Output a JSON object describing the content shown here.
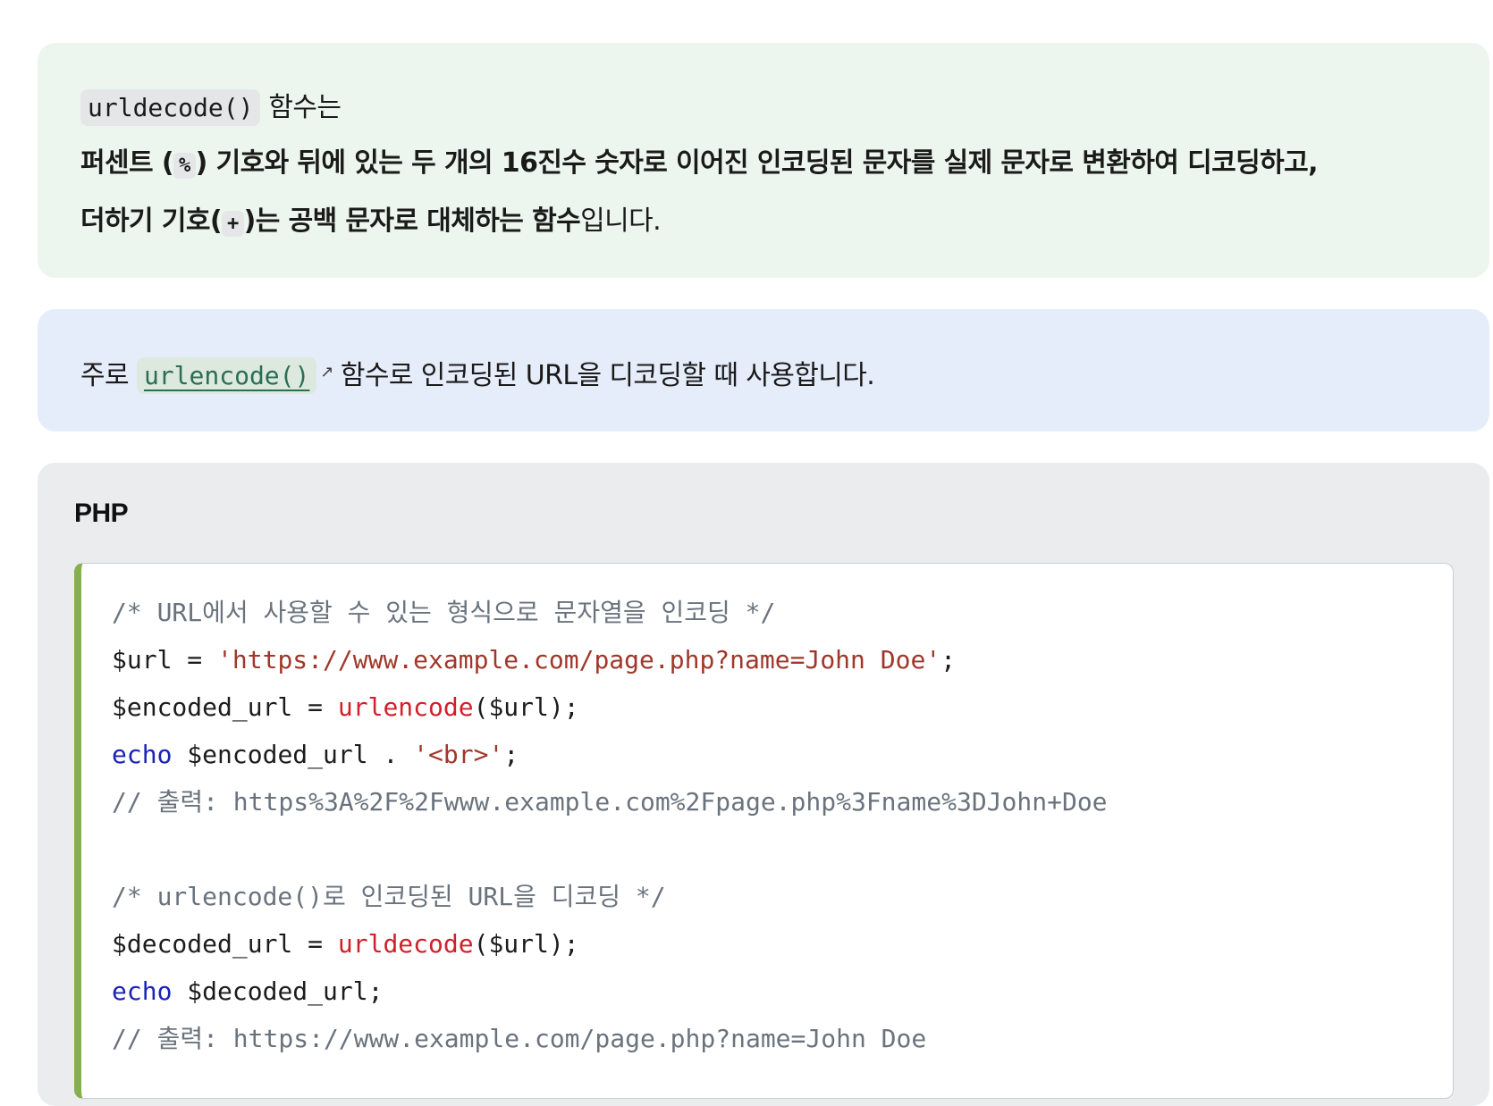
{
  "green_box": {
    "fn_name": "urldecode()",
    "line1_suffix": " 함수는",
    "line2_part1": "퍼센트 (",
    "line2_symbol": "%",
    "line2_part2": ") 기호와 뒤에 있는 두 개의 16진수 숫자로 이어진 인코딩된 문자를 실제 문자로 변환하여 디코딩하고,",
    "line3_part1": "더하기 기호(",
    "line3_symbol": "+",
    "line3_part2": ")는 공백 문자로 대체하는 함수",
    "line3_end": "입니다."
  },
  "blue_box": {
    "prefix": "주로 ",
    "link_text": "urlencode()",
    "link_icon": "external-link-icon",
    "suffix": "함수로 인코딩된 URL을 디코딩할 때 사용합니다."
  },
  "code_section": {
    "language": "PHP",
    "lines": {
      "l1_comment": "/* URL에서 사용할 수 있는 형식으로 문자열을 인코딩 */",
      "l2_var": "$url = ",
      "l2_string": "'https://www.example.com/page.php?name=John Doe'",
      "l2_end": ";",
      "l3_var": "$encoded_url = ",
      "l3_func": "urlencode",
      "l3_args": "($url);",
      "l4_kw": "echo",
      "l4_mid": " $encoded_url . ",
      "l4_string": "'<br>'",
      "l4_end": ";",
      "l5_comment": "// 출력: https%3A%2F%2Fwww.example.com%2Fpage.php%3Fname%3DJohn+Doe",
      "l7_comment": "/* urlencode()로 인코딩된 URL을 디코딩 */",
      "l8_var": "$decoded_url = ",
      "l8_func": "urldecode",
      "l8_args": "($url);",
      "l9_kw": "echo",
      "l9_rest": " $decoded_url;",
      "l10_comment": "// 출력: https://www.example.com/page.php?name=John Doe"
    }
  }
}
